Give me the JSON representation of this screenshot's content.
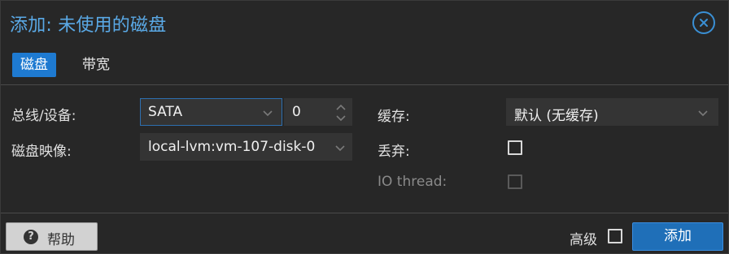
{
  "dialog": {
    "title": "添加: 未使用的磁盘"
  },
  "tabs": [
    {
      "label": "磁盘",
      "active": true
    },
    {
      "label": "带宽",
      "active": false
    }
  ],
  "form": {
    "bus_device_label": "总线/设备:",
    "bus_value": "SATA",
    "device_number": "0",
    "disk_image_label": "磁盘映像:",
    "disk_image_value": "local-lvm:vm-107-disk-0",
    "cache_label": "缓存:",
    "cache_value": "默认 (无缓存)",
    "discard_label": "丢弃:",
    "discard_checked": false,
    "io_thread_label": "IO thread:",
    "io_thread_checked": false,
    "io_thread_disabled": true
  },
  "footer": {
    "help_label": "帮助",
    "advanced_label": "高级",
    "advanced_checked": false,
    "add_label": "添加"
  },
  "colors": {
    "accent": "#1e7ad1",
    "title": "#5aa9e6",
    "background": "#272727"
  },
  "icons": {
    "close": "close-circle-icon",
    "help": "question-circle-icon",
    "dropdown": "chevron-down-icon",
    "spinner": "spinner-arrows-icon"
  }
}
